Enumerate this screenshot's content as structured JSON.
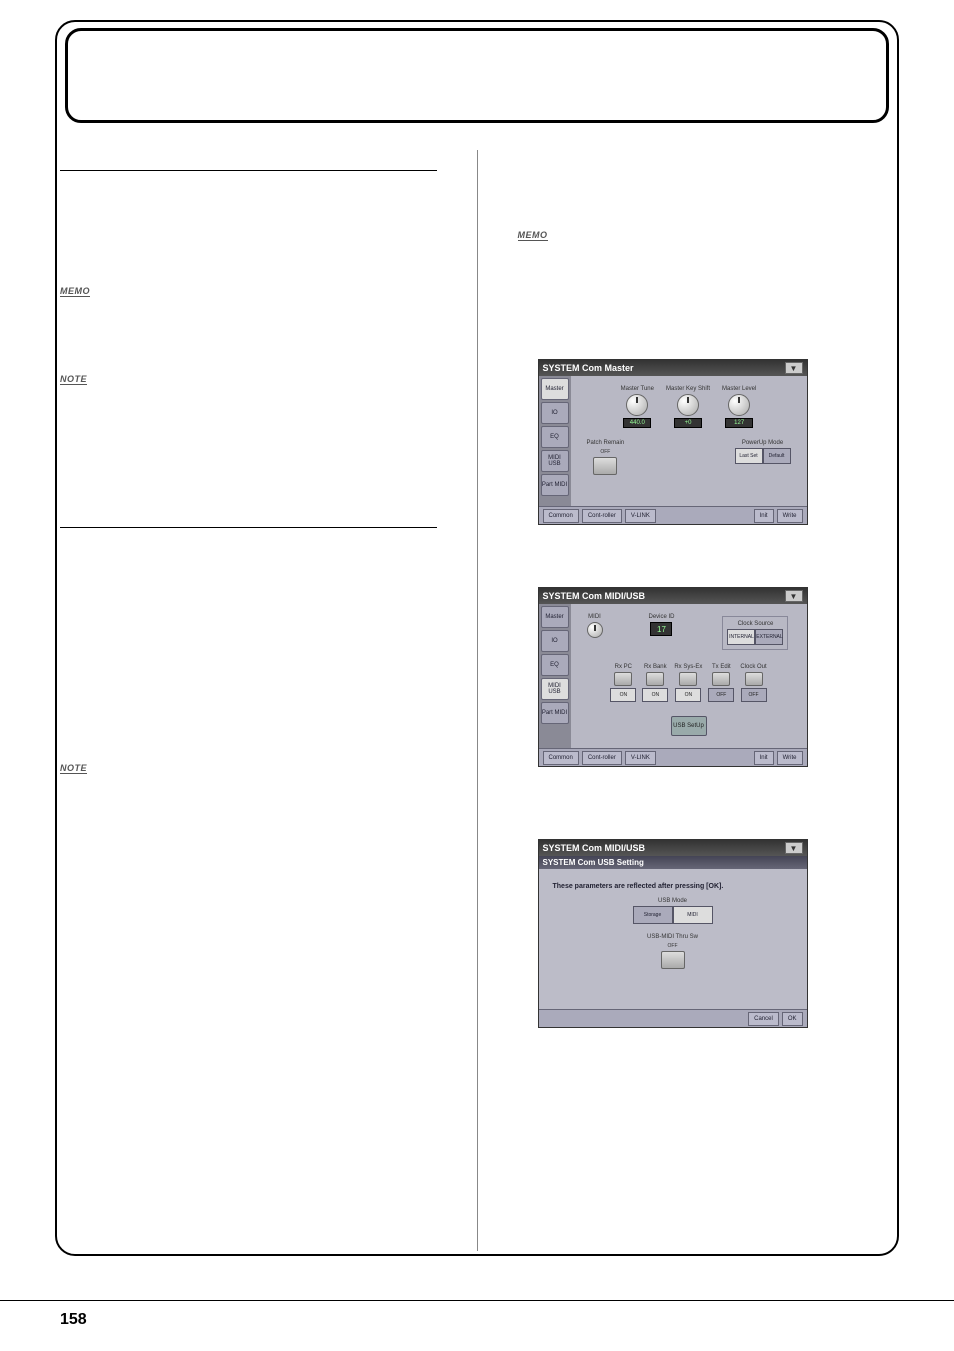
{
  "footer": {
    "page": "158"
  },
  "icons": {
    "memo": "MEMO",
    "note": "NOTE"
  },
  "screenshot_master": {
    "title": "SYSTEM Com Master",
    "sidebar": [
      "Master",
      "IO",
      "EQ",
      "MIDI USB",
      "Part MIDI"
    ],
    "row1": [
      {
        "label": "Master Tune",
        "value": "440.0"
      },
      {
        "label": "Master Key Shift",
        "value": "+0"
      },
      {
        "label": "Master Level",
        "value": "127"
      }
    ],
    "patch_remain": {
      "label": "Patch Remain",
      "value": "OFF"
    },
    "powerup": {
      "label": "PowerUp Mode",
      "opts": [
        "Last Set",
        "Default"
      ]
    },
    "bottom": {
      "left": [
        "Common",
        "Cont-roller",
        "V-LINK"
      ],
      "right": [
        "Init",
        "Write"
      ]
    }
  },
  "screenshot_midiusb": {
    "title": "SYSTEM Com MIDI/USB",
    "sidebar": [
      "Master",
      "IO",
      "EQ",
      "MIDI USB",
      "Part MIDI"
    ],
    "midi_label": "MIDI",
    "device_id": {
      "label": "Device ID",
      "value": "17"
    },
    "clock_source": {
      "label": "Clock Source",
      "opts": [
        "INTERNAL",
        "EXTERNAL"
      ]
    },
    "row2": [
      {
        "label": "Rx PC",
        "value": "ON"
      },
      {
        "label": "Rx Bank",
        "value": "ON"
      },
      {
        "label": "Rx Sys-Ex",
        "value": "ON"
      },
      {
        "label": "Tx Edit",
        "value": "OFF"
      },
      {
        "label": "Clock Out",
        "value": "OFF"
      }
    ],
    "usb_setup_btn": "USB SetUp",
    "bottom": {
      "left": [
        "Common",
        "Cont-roller",
        "V-LINK"
      ],
      "right": [
        "Init",
        "Write"
      ]
    }
  },
  "screenshot_usb": {
    "title": "SYSTEM Com MIDI/USB",
    "subtitle": "SYSTEM Com USB Setting",
    "message": "These parameters are reflected after pressing [OK].",
    "usb_mode": {
      "label": "USB Mode",
      "opts": [
        "Storage",
        "MIDI"
      ]
    },
    "thru": {
      "label": "USB-MIDI Thru Sw",
      "value": "OFF"
    },
    "bottom": {
      "right": [
        "Cancel",
        "OK"
      ]
    }
  }
}
